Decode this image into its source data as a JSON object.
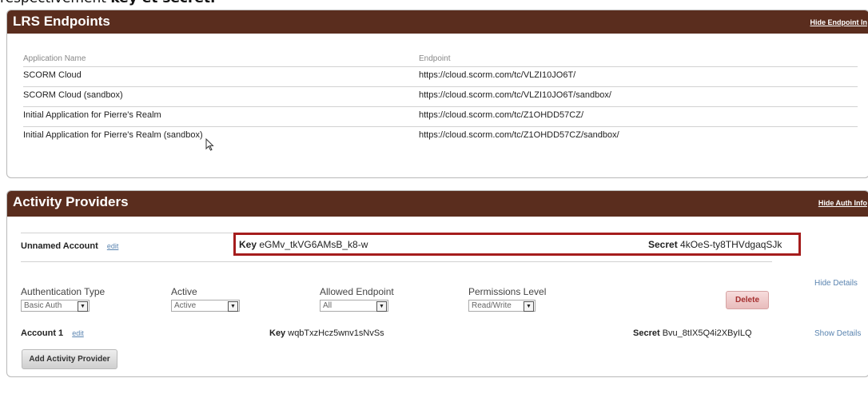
{
  "caption": {
    "prefix": "respectivement ",
    "bold": "key et secret."
  },
  "lrs": {
    "title": "LRS Endpoints",
    "hide_link": "Hide Endpoint In",
    "col_app": "Application Name",
    "col_endpoint": "Endpoint",
    "rows": [
      {
        "name": "SCORM Cloud",
        "endpoint": "https://cloud.scorm.com/tc/VLZI10JO6T/"
      },
      {
        "name": "SCORM Cloud (sandbox)",
        "endpoint": "https://cloud.scorm.com/tc/VLZI10JO6T/sandbox/"
      },
      {
        "name": "Initial Application for Pierre's Realm",
        "endpoint": "https://cloud.scorm.com/tc/Z1OHDD57CZ/"
      },
      {
        "name": "Initial Application for Pierre's Realm (sandbox)",
        "endpoint": "https://cloud.scorm.com/tc/Z1OHDD57CZ/sandbox/"
      }
    ]
  },
  "ap": {
    "title": "Activity Providers",
    "hide_link": "Hide Auth Info",
    "account0": {
      "name": "Unnamed Account",
      "edit": "edit",
      "key_label": "Key",
      "key": "eGMv_tkVG6AMsB_k8-w",
      "secret_label": "Secret",
      "secret": "4kOeS-ty8THVdgaqSJk"
    },
    "fields": {
      "auth_type_label": "Authentication Type",
      "auth_type_value": "Basic Auth",
      "active_label": "Active",
      "active_value": "Active",
      "endpoint_label": "Allowed Endpoint",
      "endpoint_value": "All",
      "perm_label": "Permissions Level",
      "perm_value": "Read/Write"
    },
    "delete": "Delete",
    "hide_details": "Hide Details",
    "account1": {
      "name": "Account 1",
      "edit": "edit",
      "key_label": "Key",
      "key": "wqbTxzHcz5wnv1sNvSs",
      "secret_label": "Secret",
      "secret": "Bvu_8tIX5Q4i2XByILQ",
      "show_details": "Show Details"
    },
    "add_button": "Add Activity Provider"
  },
  "colors": {
    "header": "#5a2d1e",
    "highlight": "#a51d1d",
    "link": "#5a84b0"
  }
}
